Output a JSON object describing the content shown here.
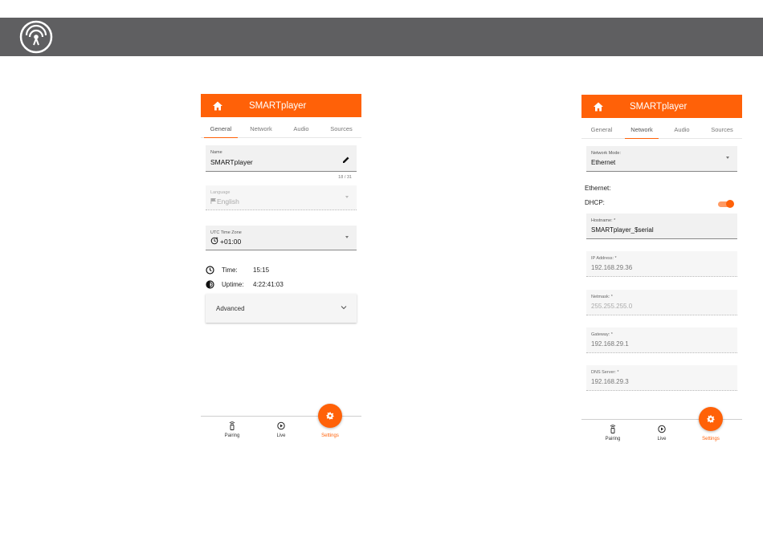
{
  "colors": {
    "accent": "#ff6108",
    "topbar": "#5f5f61"
  },
  "topbar": {
    "logo_icon": "wireless-broadcast-icon"
  },
  "left_screen": {
    "app_title": "SMARTplayer",
    "tabs": [
      {
        "label": "General",
        "active": true
      },
      {
        "label": "Network",
        "active": false
      },
      {
        "label": "Audio",
        "active": false
      },
      {
        "label": "Sources",
        "active": false
      }
    ],
    "name_field": {
      "label": "Name",
      "value": "SMARTplayer",
      "counter": "18 / 31"
    },
    "language_field": {
      "label": "Language",
      "value": "English",
      "disabled": true
    },
    "timezone_field": {
      "label": "UTC Time Zone",
      "value": "+01:00"
    },
    "time": {
      "label": "Time:",
      "value": "15:15"
    },
    "uptime": {
      "label": "Uptime:",
      "value": "4:22:41:03"
    },
    "advanced": {
      "label": "Advanced"
    },
    "nav": [
      {
        "label": "Pairing",
        "icon": "remote-icon",
        "active": false
      },
      {
        "label": "Live",
        "icon": "play-circle-icon",
        "active": false
      },
      {
        "label": "Settings",
        "icon": "gear-icon",
        "active": true
      }
    ]
  },
  "right_screen": {
    "app_title": "SMARTplayer",
    "tabs": [
      {
        "label": "General",
        "active": false
      },
      {
        "label": "Network",
        "active": true
      },
      {
        "label": "Audio",
        "active": false
      },
      {
        "label": "Sources",
        "active": false
      }
    ],
    "network_mode": {
      "label": "Network Mode:",
      "value": "Ethernet"
    },
    "ethernet_heading": "Ethernet:",
    "dhcp": {
      "label": "DHCP:",
      "enabled": true
    },
    "hostname": {
      "label": "Hostname: *",
      "value": "SMARTplayer_$serial"
    },
    "ip_address": {
      "label": "IP Address: *",
      "value": "192.168.29.36"
    },
    "netmask": {
      "label": "Netmask: *",
      "value": "255.255.255.0"
    },
    "gateway": {
      "label": "Gateway: *",
      "value": "192.168.29.1"
    },
    "dns_server": {
      "label": "DNS Server: *",
      "value": "192.168.29.3"
    },
    "nav": [
      {
        "label": "Pairing",
        "icon": "remote-icon",
        "active": false
      },
      {
        "label": "Live",
        "icon": "play-circle-icon",
        "active": false
      },
      {
        "label": "Settings",
        "icon": "gear-icon",
        "active": true
      }
    ]
  }
}
